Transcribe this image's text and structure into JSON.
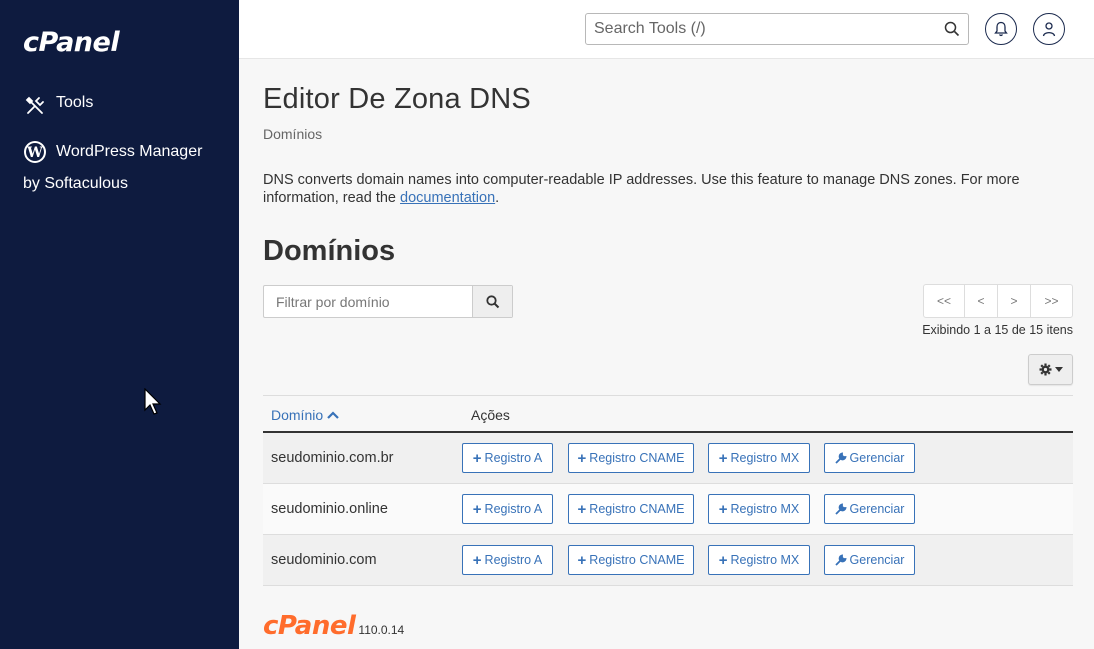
{
  "sidebar": {
    "logo": "cPanel",
    "items": [
      {
        "label": "Tools",
        "icon": "tools-icon"
      },
      {
        "label": "WordPress Manager",
        "label_line2": "by Softaculous",
        "icon": "wordpress-icon"
      }
    ]
  },
  "header": {
    "search_placeholder": "Search Tools (/)",
    "icons": [
      "search-icon",
      "bell-icon",
      "user-icon"
    ]
  },
  "main": {
    "title": "Editor De Zona DNS",
    "breadcrumb": "Domínios",
    "description_text": "DNS converts domain names into computer-readable IP addresses. Use this feature to manage DNS zones. For more information, read the ",
    "description_link": "documentation",
    "description_end": ".",
    "section_title": "Domínios",
    "filter_placeholder": "Filtrar por domínio",
    "pager": {
      "first": "<<",
      "prev": "<",
      "next": ">",
      "last": ">>"
    },
    "showing": "Exibindo 1 a 15 de 15 itens",
    "table": {
      "col_domain": "Domínio",
      "col_actions": "Ações",
      "buttons": {
        "a": "Registro A",
        "cname": "Registro CNAME",
        "mx": "Registro MX",
        "manage": "Gerenciar"
      },
      "rows": [
        {
          "domain": "seudominio.com.br"
        },
        {
          "domain": "seudominio.online"
        },
        {
          "domain": "seudominio.com"
        }
      ]
    }
  },
  "footer": {
    "logo": "cPanel",
    "version": "110.0.14"
  },
  "colors": {
    "sidebar_bg": "#0e1b3f",
    "link": "#3872b8",
    "footer_logo": "#ff6c2c"
  }
}
